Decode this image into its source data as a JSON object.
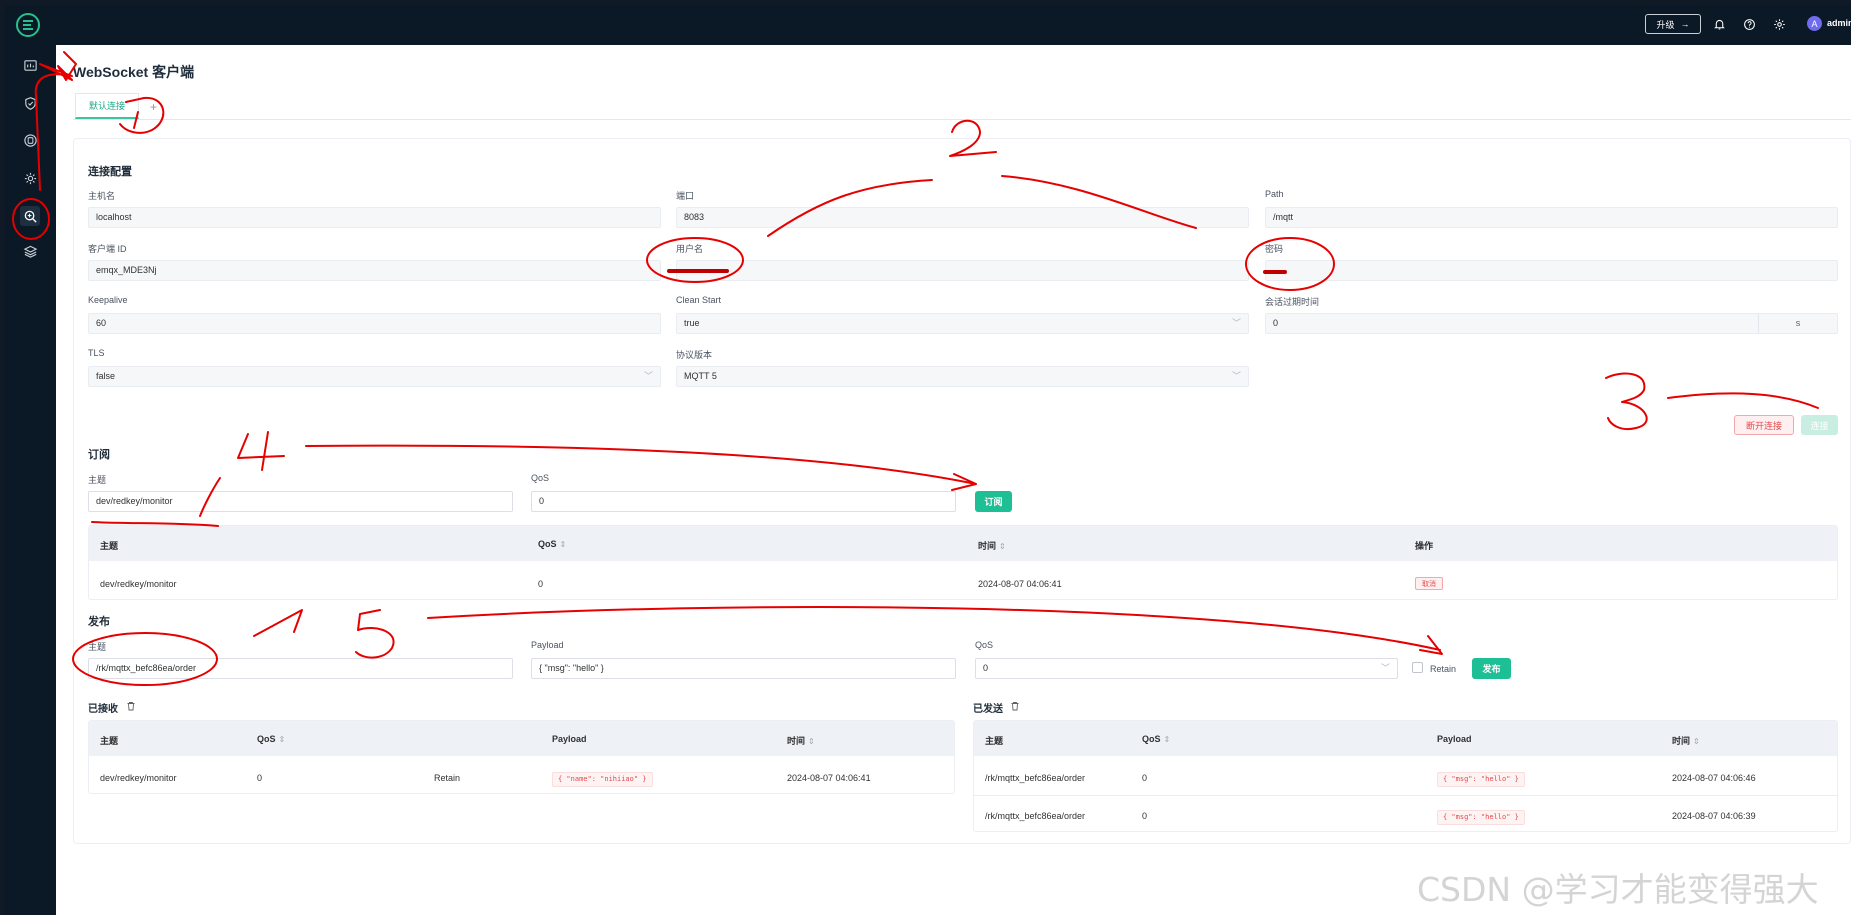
{
  "app": {
    "upgrade_label": "升级",
    "user_initial": "A",
    "user_name": "admin"
  },
  "sidebar": {
    "items": [
      {
        "icon": "dashboard-icon"
      },
      {
        "icon": "shield-icon"
      },
      {
        "icon": "database-icon"
      },
      {
        "icon": "gear-cog-icon"
      },
      {
        "icon": "diagnose-search-icon"
      },
      {
        "icon": "layers-icon"
      }
    ]
  },
  "page": {
    "title": "WebSocket 客户端",
    "tab_label": "默认连接",
    "tab_add": "+"
  },
  "connection": {
    "section_title": "连接配置",
    "host_label": "主机名",
    "host_value": "localhost",
    "port_label": "端口",
    "port_value": "8083",
    "path_label": "Path",
    "path_value": "/mqtt",
    "clientid_label": "客户端 ID",
    "clientid_value": "emqx_MDE3Nj",
    "username_label": "用户名",
    "password_label": "密码",
    "keepalive_label": "Keepalive",
    "keepalive_value": "60",
    "cleanstart_label": "Clean Start",
    "cleanstart_value": "true",
    "session_label": "会话过期时间",
    "session_value": "0",
    "session_unit": "s",
    "tls_label": "TLS",
    "tls_value": "false",
    "protocol_label": "协议版本",
    "protocol_value": "MQTT 5",
    "disconnect_label": "断开连接",
    "connect_label": "连接"
  },
  "subscribe": {
    "section_title": "订阅",
    "topic_label": "主题",
    "topic_value": "dev/redkey/monitor",
    "qos_label": "QoS",
    "qos_value": "0",
    "button_label": "订阅",
    "columns": [
      "主题",
      "QoS",
      "时间",
      "操作"
    ],
    "rows": [
      {
        "topic": "dev/redkey/monitor",
        "qos": "0",
        "time": "2024-08-07 04:06:41",
        "action": "取消"
      }
    ]
  },
  "publish": {
    "section_title": "发布",
    "topic_label": "主题",
    "topic_value": "/rk/mqttx_befc86ea/order",
    "payload_label": "Payload",
    "payload_value": "{ \"msg\": \"hello\" }",
    "qos_label": "QoS",
    "qos_value": "0",
    "retain_label": "Retain",
    "button_label": "发布"
  },
  "received": {
    "title": "已接收",
    "columns": [
      "主题",
      "QoS",
      "Payload",
      "时间"
    ],
    "rows": [
      {
        "topic": "dev/redkey/monitor",
        "qos": "0",
        "retain": "Retain",
        "payload": "{ \"name\": \"nihiiao\" }",
        "time": "2024-08-07 04:06:41"
      }
    ]
  },
  "sent": {
    "title": "已发送",
    "columns": [
      "主题",
      "QoS",
      "Payload",
      "时间"
    ],
    "rows": [
      {
        "topic": "/rk/mqttx_befc86ea/order",
        "qos": "0",
        "payload": "{ \"msg\": \"hello\" }",
        "time": "2024-08-07 04:06:46"
      },
      {
        "topic": "/rk/mqttx_befc86ea/order",
        "qos": "0",
        "payload": "{ \"msg\": \"hello\" }",
        "time": "2024-08-07 04:06:39"
      }
    ]
  },
  "watermark": "CSDN @学习才能变得强大",
  "colors": {
    "primary": "#1fbf95",
    "sidebar_bg": "#0b1825",
    "danger": "#e64b4b",
    "annotation": "#e60000"
  }
}
